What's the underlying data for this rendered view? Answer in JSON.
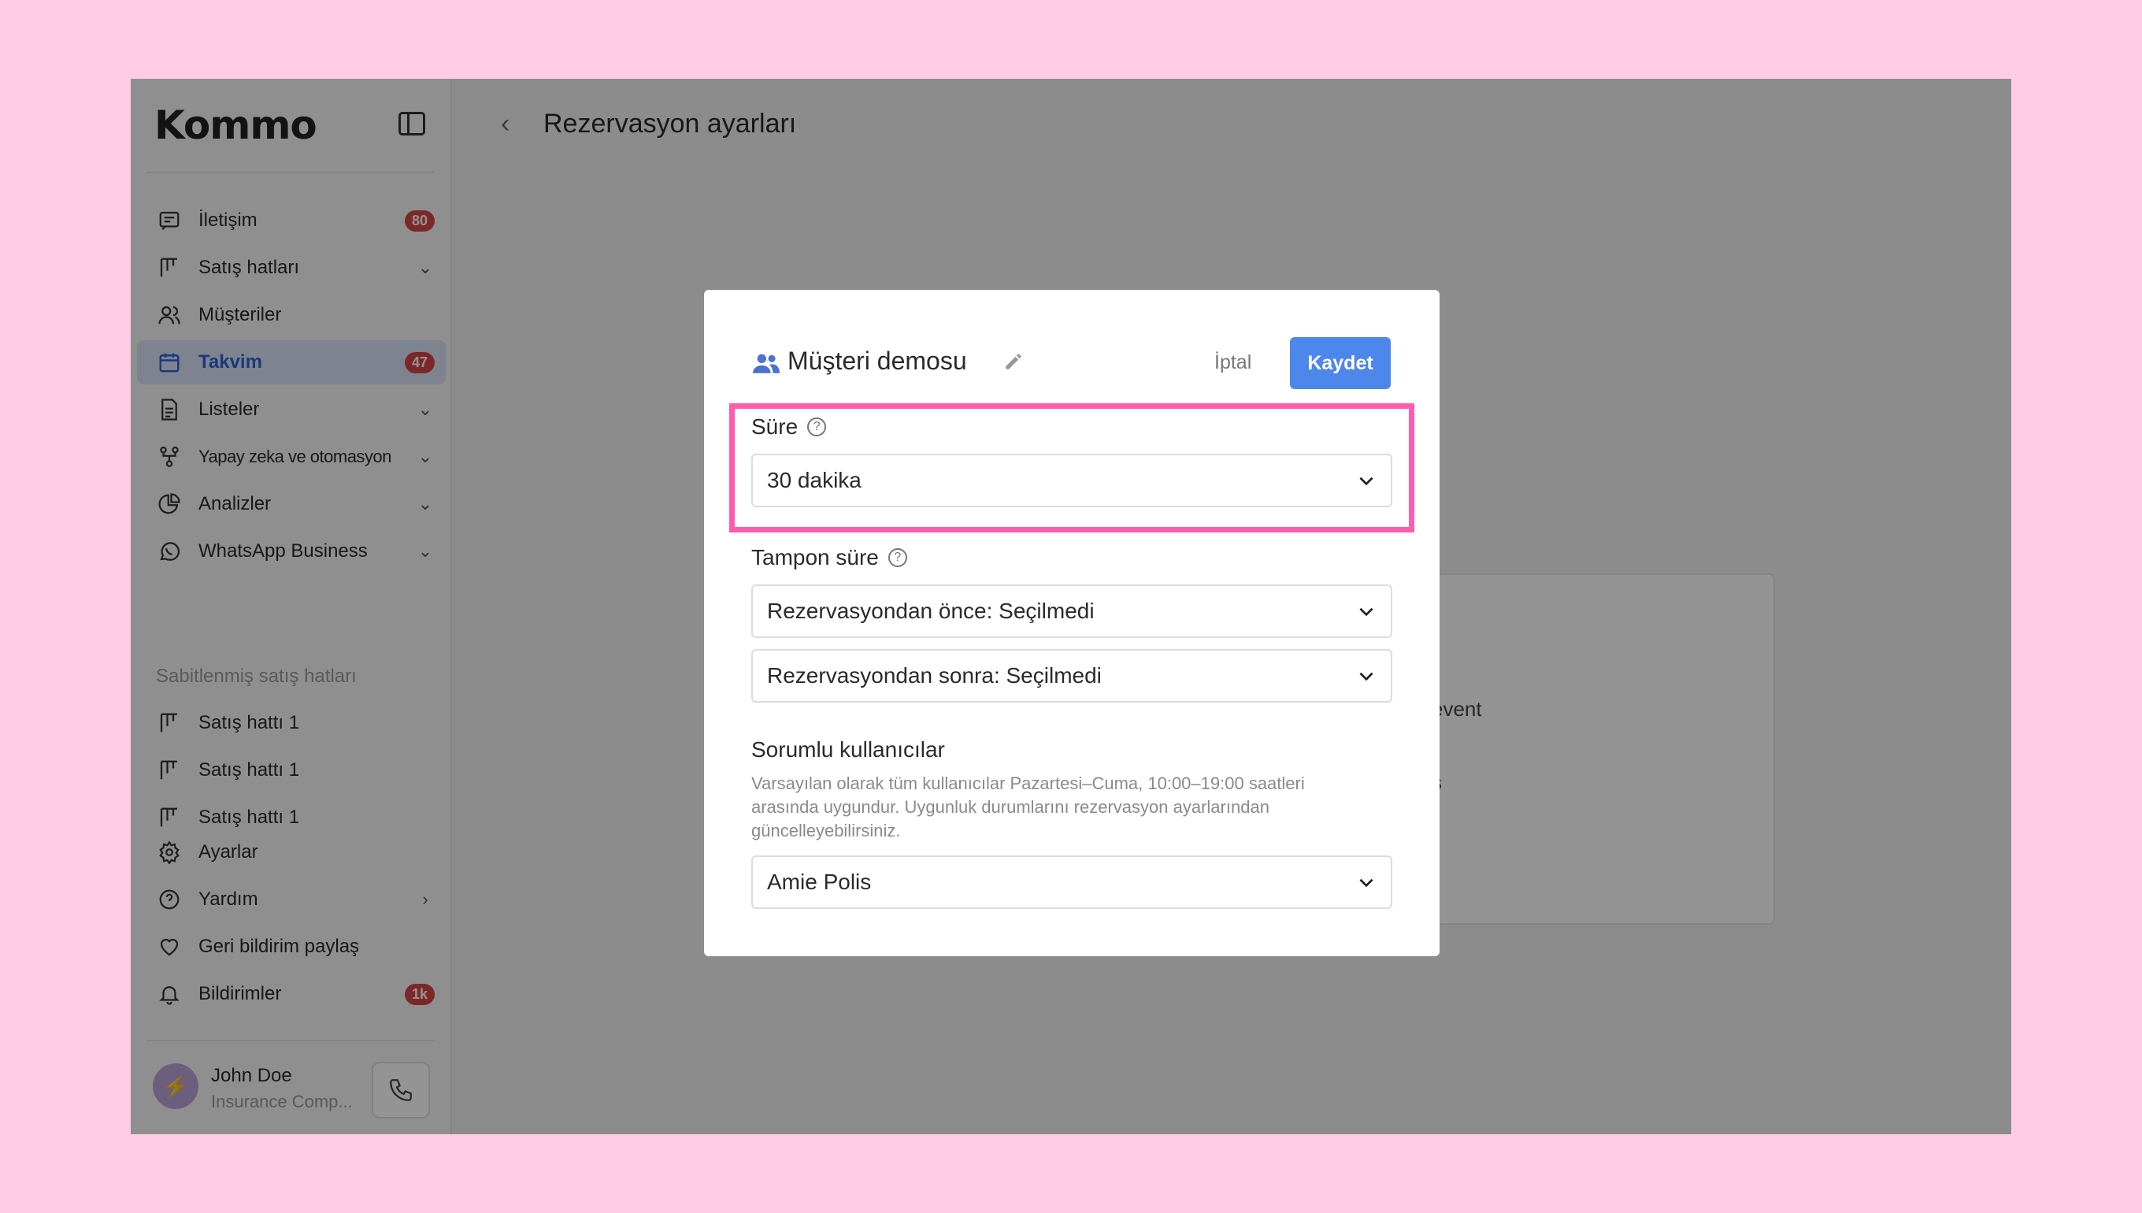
{
  "app": {
    "logo": "Kommo",
    "page_title": "Rezervasyon ayarları"
  },
  "sidebar": {
    "items": [
      {
        "label": "İletişim",
        "badge": "80"
      },
      {
        "label": "Satış hatları"
      },
      {
        "label": "Müşteriler"
      },
      {
        "label": "Takvim",
        "badge": "47"
      },
      {
        "label": "Listeler"
      },
      {
        "label": "Yapay zeka ve otomasyon"
      },
      {
        "label": "Analizler"
      },
      {
        "label": "WhatsApp Business"
      }
    ],
    "pinned_section": "Sabitlenmiş satış hatları",
    "pinned": [
      {
        "label": "Satış hattı 1"
      },
      {
        "label": "Satış hattı 1"
      },
      {
        "label": "Satış hattı 1"
      }
    ],
    "bottom": [
      {
        "label": "Ayarlar"
      },
      {
        "label": "Yardım"
      },
      {
        "label": "Geri bildirim paylaş"
      },
      {
        "label": "Bildirimler",
        "badge": "1k"
      }
    ],
    "user": {
      "name": "John Doe",
      "company": "Insurance Comp..."
    }
  },
  "background": {
    "text1": "event",
    "text2": "s"
  },
  "modal": {
    "title": "Müşteri demosu",
    "cancel_label": "İptal",
    "save_label": "Kaydet",
    "duration": {
      "label": "Süre",
      "value": "30 dakika"
    },
    "buffer": {
      "label": "Tampon süre",
      "before": "Rezervasyondan önce: Seçilmedi",
      "after": "Rezervasyondan sonra: Seçilmedi"
    },
    "responsible": {
      "label": "Sorumlu kullanıcılar",
      "description": "Varsayılan olarak tüm kullanıcılar Pazartesi–Cuma, 10:00–19:00 saatleri arasında uygundur. Uygunluk durumlarını rezervasyon ayarlarından güncelleyebilirsiniz.",
      "value": "Amie Polis"
    }
  },
  "colors": {
    "accent": "#4d87ec",
    "highlight": "#ff5cad",
    "badge": "#d64545",
    "active_bg": "#d8e4f7"
  }
}
